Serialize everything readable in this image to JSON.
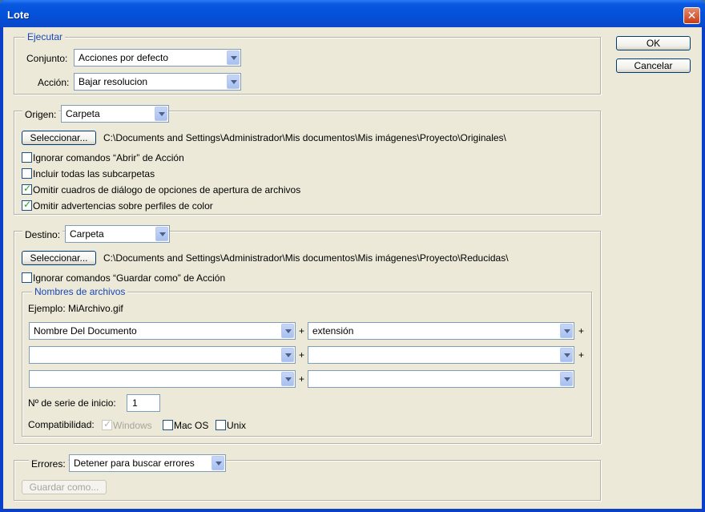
{
  "window": {
    "title": "Lote",
    "close_label": "✕"
  },
  "buttons": {
    "ok": "OK",
    "cancel": "Cancelar"
  },
  "ejecutar": {
    "legend": "Ejecutar",
    "conjunto_label": "Conjunto:",
    "conjunto_value": "Acciones por defecto",
    "accion_label": "Acción:",
    "accion_value": "Bajar resolucion"
  },
  "origen": {
    "label": "Origen:",
    "value": "Carpeta",
    "select_button": "Seleccionar...",
    "path": "C:\\Documents and Settings\\Administrador\\Mis documentos\\Mis imágenes\\Proyecto\\Originales\\",
    "options": [
      {
        "label": "Ignorar comandos “Abrir” de Acción",
        "checked": false
      },
      {
        "label": "Incluir todas las subcarpetas",
        "checked": false
      },
      {
        "label": "Omitir cuadros de diálogo de opciones de apertura de archivos",
        "checked": true
      },
      {
        "label": "Omitir advertencias sobre perfiles de color",
        "checked": true
      }
    ]
  },
  "destino": {
    "label": "Destino:",
    "value": "Carpeta",
    "select_button": "Seleccionar...",
    "path": "C:\\Documents and Settings\\Administrador\\Mis documentos\\Mis imágenes\\Proyecto\\Reducidas\\",
    "ignore_save": {
      "label": "Ignorar comandos “Guardar como” de Acción",
      "checked": false
    },
    "naming": {
      "legend": "Nombres de archivos",
      "example": "Ejemplo: MiArchivo.gif",
      "rows": [
        {
          "left": "Nombre Del Documento",
          "right": "extensión",
          "plus_mid": "+",
          "plus_end": "+"
        },
        {
          "left": "",
          "right": "",
          "plus_mid": "+",
          "plus_end": "+"
        },
        {
          "left": "",
          "right": "",
          "plus_mid": "+",
          "plus_end": ""
        }
      ],
      "serial_label": "Nº de serie de inicio:",
      "serial_value": "1",
      "compat_label": "Compatibilidad:",
      "compat": [
        {
          "label": "Windows",
          "checked": true,
          "disabled": true
        },
        {
          "label": "Mac OS",
          "checked": false,
          "disabled": false
        },
        {
          "label": "Unix",
          "checked": false,
          "disabled": false
        }
      ]
    }
  },
  "errores": {
    "label": "Errores:",
    "value": "Detener para buscar errores",
    "save_as": "Guardar como..."
  }
}
